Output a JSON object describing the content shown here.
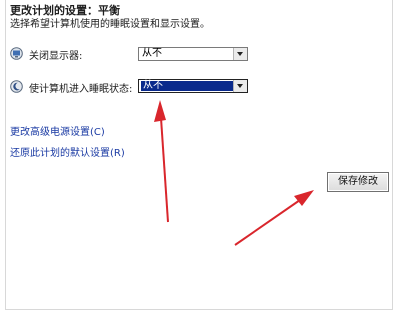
{
  "header": {
    "title": "更改计划的设置：平衡",
    "subtitle": "选择希望计算机使用的睡眠设置和显示设置。"
  },
  "settings": [
    {
      "label": "关闭显示器:",
      "icon": "monitor-icon",
      "value": "从不"
    },
    {
      "label": "使计算机进入睡眠状态:",
      "icon": "moon-icon",
      "value": "从不"
    }
  ],
  "links": {
    "advanced": "更改高级电源设置(C)",
    "restore": "还原此计划的默认设置(R)"
  },
  "buttons": {
    "save": "保存修改"
  },
  "colors": {
    "annotation_arrow": "#d9262c",
    "link": "#1a3aa3",
    "selection": "#0a2a8c"
  }
}
